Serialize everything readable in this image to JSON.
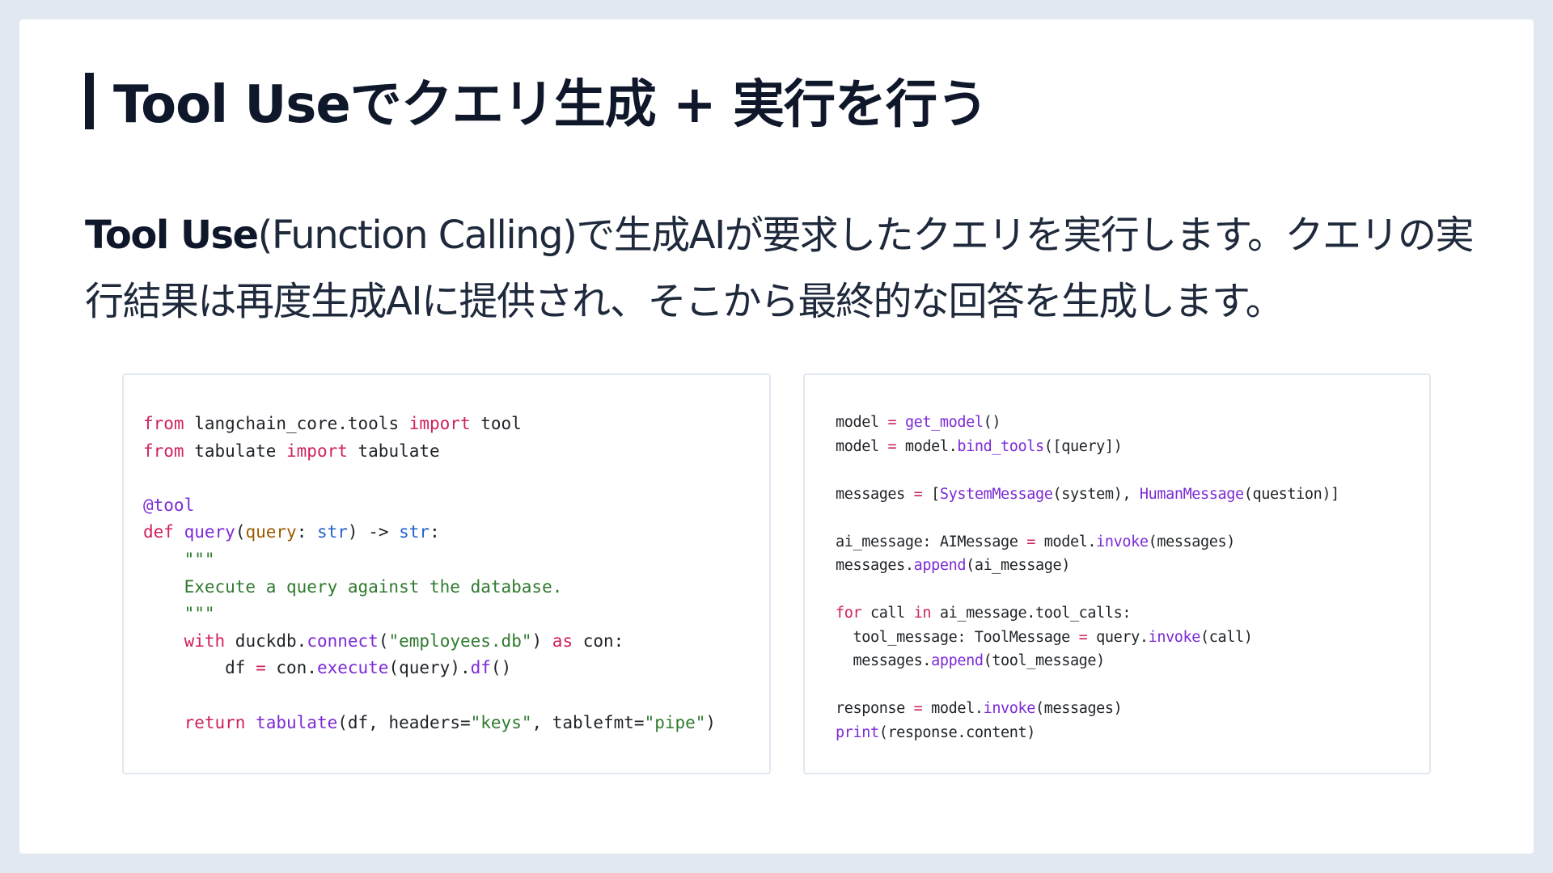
{
  "slide": {
    "title": "Tool Useでクエリ生成 + 実行を行う",
    "description_lead": "Tool Use",
    "description_rest": "(Function Calling)で生成AIが要求したクエリを実行します。クエリの実行結果は再度生成AIに提供され、そこから最終的な回答を生成します。"
  },
  "code_left": {
    "lines": [
      [
        {
          "t": "from",
          "c": "k"
        },
        {
          "t": " langchain_core.tools "
        },
        {
          "t": "import",
          "c": "k"
        },
        {
          "t": " tool"
        }
      ],
      [
        {
          "t": "from",
          "c": "k"
        },
        {
          "t": " tabulate "
        },
        {
          "t": "import",
          "c": "k"
        },
        {
          "t": " tabulate"
        }
      ],
      [],
      [
        {
          "t": "@tool",
          "c": "f"
        }
      ],
      [
        {
          "t": "def",
          "c": "k"
        },
        {
          "t": " "
        },
        {
          "t": "query",
          "c": "f"
        },
        {
          "t": "("
        },
        {
          "t": "query",
          "c": "p"
        },
        {
          "t": ": "
        },
        {
          "t": "str",
          "c": "t"
        },
        {
          "t": ") -> "
        },
        {
          "t": "str",
          "c": "t"
        },
        {
          "t": ":"
        }
      ],
      [
        {
          "t": "    \"\"\"",
          "c": "c"
        }
      ],
      [
        {
          "t": "    Execute a query against the database.",
          "c": "c"
        }
      ],
      [
        {
          "t": "    \"\"\"",
          "c": "c"
        }
      ],
      [
        {
          "t": "    "
        },
        {
          "t": "with",
          "c": "k"
        },
        {
          "t": " duckdb."
        },
        {
          "t": "connect",
          "c": "f"
        },
        {
          "t": "("
        },
        {
          "t": "\"employees.db\"",
          "c": "c"
        },
        {
          "t": ") "
        },
        {
          "t": "as",
          "c": "k"
        },
        {
          "t": " con:"
        }
      ],
      [
        {
          "t": "        df "
        },
        {
          "t": "=",
          "c": "k"
        },
        {
          "t": " con."
        },
        {
          "t": "execute",
          "c": "f"
        },
        {
          "t": "(query)."
        },
        {
          "t": "df",
          "c": "f"
        },
        {
          "t": "()"
        }
      ],
      [],
      [
        {
          "t": "    "
        },
        {
          "t": "return",
          "c": "k"
        },
        {
          "t": " "
        },
        {
          "t": "tabulate",
          "c": "f"
        },
        {
          "t": "(df, headers="
        },
        {
          "t": "\"keys\"",
          "c": "c"
        },
        {
          "t": ", tablefmt="
        },
        {
          "t": "\"pipe\"",
          "c": "c"
        },
        {
          "t": ")"
        }
      ]
    ]
  },
  "code_right": {
    "lines": [
      [
        {
          "t": "model "
        },
        {
          "t": "=",
          "c": "k"
        },
        {
          "t": " "
        },
        {
          "t": "get_model",
          "c": "f"
        },
        {
          "t": "()"
        }
      ],
      [
        {
          "t": "model "
        },
        {
          "t": "=",
          "c": "k"
        },
        {
          "t": " model."
        },
        {
          "t": "bind_tools",
          "c": "f"
        },
        {
          "t": "([query])"
        }
      ],
      [],
      [
        {
          "t": "messages "
        },
        {
          "t": "=",
          "c": "k"
        },
        {
          "t": " ["
        },
        {
          "t": "SystemMessage",
          "c": "f"
        },
        {
          "t": "(system), "
        },
        {
          "t": "HumanMessage",
          "c": "f"
        },
        {
          "t": "(question)]"
        }
      ],
      [],
      [
        {
          "t": "ai_message: AIMessage "
        },
        {
          "t": "=",
          "c": "k"
        },
        {
          "t": " model."
        },
        {
          "t": "invoke",
          "c": "f"
        },
        {
          "t": "(messages)"
        }
      ],
      [
        {
          "t": "messages."
        },
        {
          "t": "append",
          "c": "f"
        },
        {
          "t": "(ai_message)"
        }
      ],
      [],
      [
        {
          "t": "for",
          "c": "k"
        },
        {
          "t": " call "
        },
        {
          "t": "in",
          "c": "k"
        },
        {
          "t": " ai_message.tool_calls:"
        }
      ],
      [
        {
          "t": "  tool_message: ToolMessage "
        },
        {
          "t": "=",
          "c": "k"
        },
        {
          "t": " query."
        },
        {
          "t": "invoke",
          "c": "f"
        },
        {
          "t": "(call)"
        }
      ],
      [
        {
          "t": "  messages."
        },
        {
          "t": "append",
          "c": "f"
        },
        {
          "t": "(tool_message)"
        }
      ],
      [],
      [
        {
          "t": "response "
        },
        {
          "t": "=",
          "c": "k"
        },
        {
          "t": " model."
        },
        {
          "t": "invoke",
          "c": "f"
        },
        {
          "t": "(messages)"
        }
      ],
      [
        {
          "t": "print",
          "c": "f"
        },
        {
          "t": "(response.content)"
        }
      ]
    ]
  }
}
